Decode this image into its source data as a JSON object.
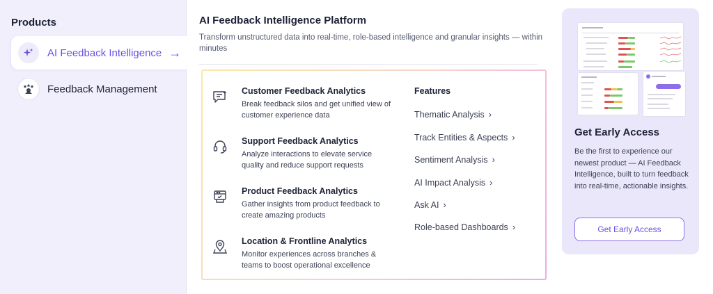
{
  "sidebar": {
    "title": "Products",
    "items": [
      {
        "label": "AI Feedback Intelligence",
        "icon": "sparkle-icon",
        "active": true
      },
      {
        "label": "Feedback Management",
        "icon": "stars-group-icon",
        "active": false
      }
    ]
  },
  "main": {
    "title": "AI Feedback Intelligence Platform",
    "description": "Transform unstructured data into real-time, role-based intelligence and granular insights — within minutes",
    "products": [
      {
        "title": "Customer Feedback Analytics",
        "desc": "Break feedback silos and get unified view of customer experience data",
        "icon": "chat-bubble-icon"
      },
      {
        "title": "Support Feedback Analytics",
        "desc": "Analyze interactions to elevate service quality and reduce support requests",
        "icon": "headset-icon"
      },
      {
        "title": "Product Feedback Analytics",
        "desc": "Gather insights from product feedback to create amazing products",
        "icon": "product-box-icon"
      },
      {
        "title": "Location & Frontline Analytics",
        "desc": "Monitor experiences across branches & teams to boost operational excellence",
        "icon": "location-pin-icon"
      }
    ],
    "features_title": "Features",
    "features": [
      "Thematic Analysis",
      "Track Entities & Aspects",
      "Sentiment Analysis",
      "AI Impact Analysis",
      "Ask AI",
      "Role-based Dashboards"
    ]
  },
  "card": {
    "title": "Get Early Access",
    "description": "Be the first to experience our newest product — AI Feedback Intelligence, built to turn feedback into real-time, actionable insights.",
    "cta": "Get Early Access"
  },
  "colors": {
    "accent": "#6b4fe6",
    "sidebar_bg": "#f1effc",
    "card_bg": "#ebe7fb"
  }
}
